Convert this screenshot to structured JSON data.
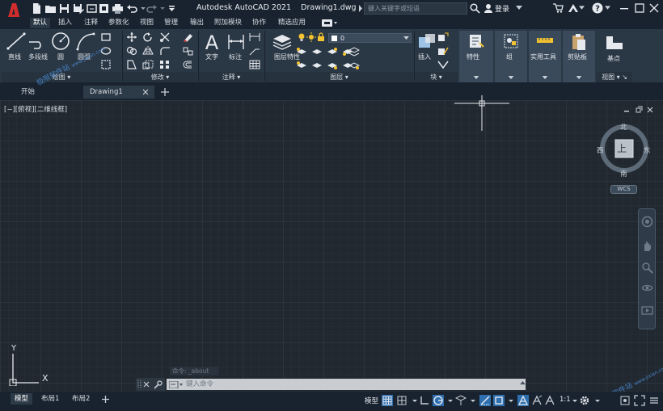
{
  "title_bar": {
    "title": "Autodesk AutoCAD 2021    Drawing1.dwg",
    "search_placeholder": "键入关键字或短语",
    "login_label": "登录"
  },
  "ribbon_tabs": [
    "默认",
    "插入",
    "注释",
    "参数化",
    "视图",
    "管理",
    "输出",
    "附加模块",
    "协作",
    "精选应用"
  ],
  "ribbon_panels": {
    "draw": {
      "title": "绘图",
      "tools": [
        "直线",
        "多段线",
        "圆",
        "圆弧"
      ]
    },
    "modify": {
      "title": "修改"
    },
    "annotation": {
      "title": "注释",
      "tools": [
        "文字",
        "标注"
      ]
    },
    "layers": {
      "title": "图层",
      "tools": [
        "图层特性"
      ],
      "current_layer": "0"
    },
    "block": {
      "title": "块",
      "tools": [
        "插入"
      ]
    },
    "properties": {
      "label": "特性"
    },
    "group": {
      "label": "组"
    },
    "utilities": {
      "label": "实用工具"
    },
    "clipboard": {
      "label": "剪贴板"
    },
    "view": {
      "title": "视图",
      "tools": [
        "基点"
      ]
    }
  },
  "doc_tabs": [
    "开始",
    "Drawing1"
  ],
  "viewport_label": "[−][俯视][二维线框]",
  "viewcube": {
    "top_face": "上",
    "north": "北",
    "south": "南",
    "east": "东",
    "west": "西",
    "wcs": "WCS"
  },
  "ucs": {
    "x": "X",
    "y": "Y"
  },
  "command": {
    "history": "命令: _about",
    "placeholder": "键入命令"
  },
  "layout_tabs": [
    "模型",
    "布局1",
    "布局2"
  ],
  "status": {
    "model_label": "模型",
    "scale": "1:1"
  },
  "watermark": {
    "text": "极限软件站",
    "url": "www.jixian.com"
  },
  "colors": {
    "accent": "#2e6fb0",
    "logo_red": "#d22d2d",
    "background": "#212830"
  }
}
